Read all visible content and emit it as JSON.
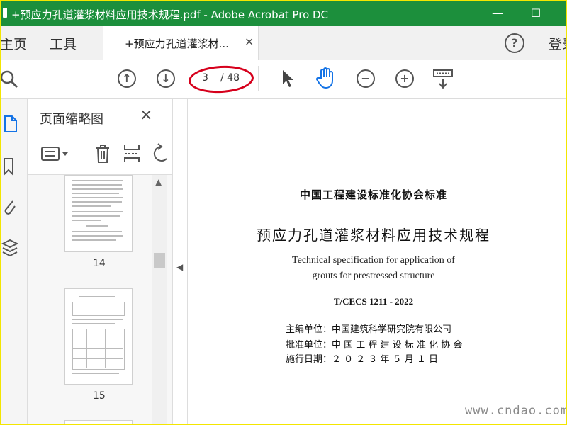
{
  "window": {
    "title": "+预应力孔道灌浆材料应用技术规程.pdf - Adobe Acrobat Pro DC",
    "minimize": "—",
    "maximize": "☐"
  },
  "tabs": {
    "home": "主页",
    "tools": "工具",
    "document": "+预应力孔道灌浆材...",
    "close": "×",
    "help": "?",
    "login": "登录"
  },
  "toolbar": {
    "current_page": "3",
    "total_pages": "/ 48"
  },
  "panel": {
    "title": "页面缩略图",
    "close": "×",
    "thumbnails": [
      {
        "label": "14"
      },
      {
        "label": "15"
      }
    ]
  },
  "document": {
    "org": "中国工程建设标准化协会标准",
    "title_cn": "预应力孔道灌浆材料应用技术规程",
    "title_en_line1": "Technical specification for application of",
    "title_en_line2": "grouts for prestressed structure",
    "code": "T/CECS 1211 - 2022",
    "editor": "主编单位：中国建筑科学研究院有限公司",
    "approver": "批准单位：中 国 工 程 建 设 标 准 化 协 会",
    "date": "施行日期：２ ０ ２ ３ 年 ５ 月 １ 日"
  },
  "watermark": {
    "site": "www.cndao.com"
  },
  "colors": {
    "titlebar": "#1c8f3c",
    "accent_blue": "#1473e6",
    "highlight_oval": "#d6001c",
    "frame": "#f3e600"
  }
}
